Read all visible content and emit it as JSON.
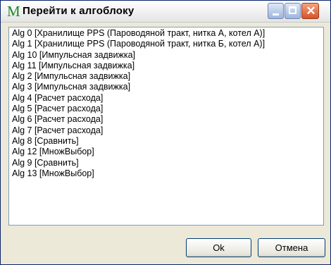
{
  "window": {
    "title": "Перейти к алгоблоку",
    "app_icon_glyph": "M",
    "icon_color": "#1a8a2a"
  },
  "titlebar_buttons": {
    "minimize_icon": "minimize-icon",
    "maximize_icon": "maximize-icon",
    "close_icon": "close-icon",
    "close_glyph": "✕"
  },
  "list": {
    "items": [
      "Alg 0  [Хранилище PPS (Пароводяной тракт, нитка А, котел А)]",
      "Alg 1  [Хранилище PPS (Пароводяной тракт, нитка Б, котел А)]",
      "Alg 10  [Импульсная задвижка]",
      "Alg 11  [Импульсная задвижка]",
      "Alg 2  [Импульсная задвижка]",
      "Alg 3  [Импульсная задвижка]",
      "Alg 4  [Расчет расхода]",
      "Alg 5  [Расчет расхода]",
      "Alg 6  [Расчет расхода]",
      "Alg 7  [Расчет расхода]",
      "Alg 8  [Сравнить]",
      "Alg 12  [МножВыбор]",
      "Alg 9  [Сравнить]",
      "Alg 13  [МножВыбор]"
    ]
  },
  "buttons": {
    "ok_label": "Ok",
    "cancel_label": "Отмена"
  }
}
